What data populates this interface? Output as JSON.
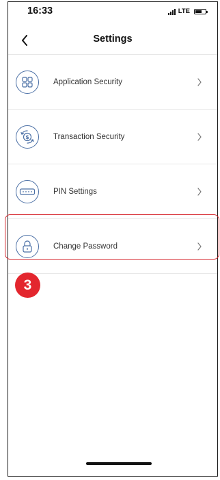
{
  "status_bar": {
    "time": "16:33",
    "network": "LTE"
  },
  "nav": {
    "title": "Settings"
  },
  "settings": {
    "items": [
      {
        "label": "Application Security",
        "icon": "grid-icon"
      },
      {
        "label": "Transaction Security",
        "icon": "dollar-shield-icon"
      },
      {
        "label": "PIN Settings",
        "icon": "pin-dots-icon"
      },
      {
        "label": "Change Password",
        "icon": "lock-icon"
      }
    ]
  },
  "annotation": {
    "step": "3",
    "highlight_color": "#d7282f"
  },
  "colors": {
    "icon_accent": "#4a6fa5",
    "badge": "#e3262e"
  }
}
